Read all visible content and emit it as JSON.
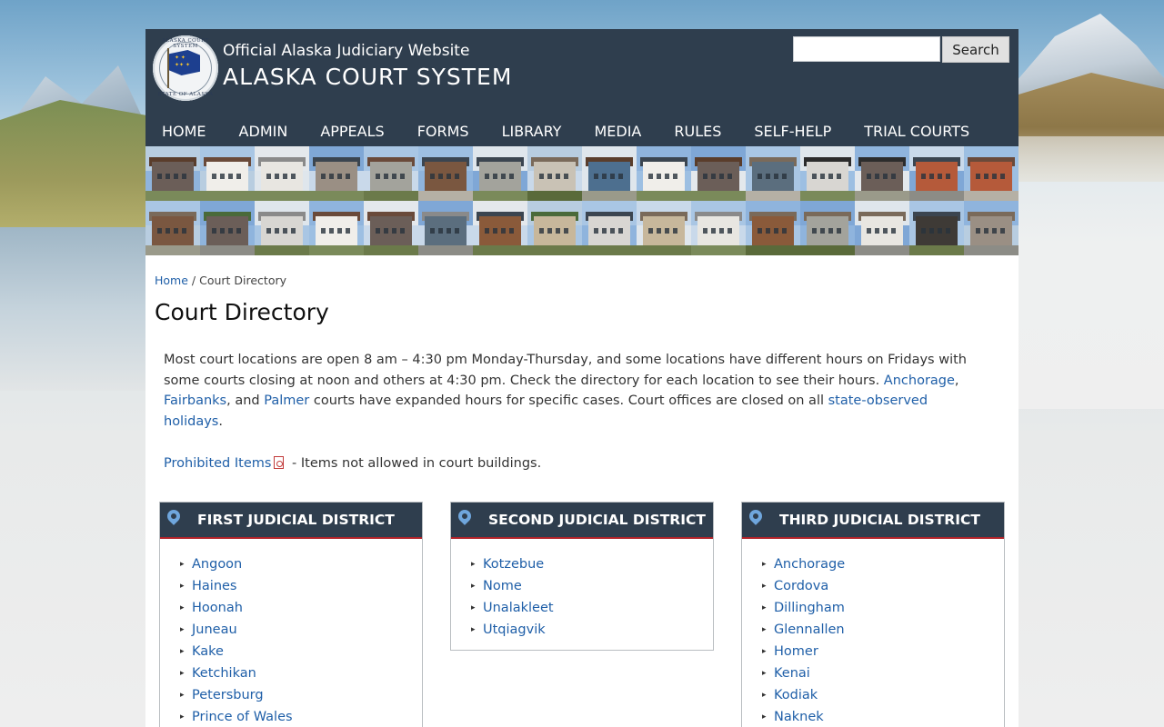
{
  "header": {
    "seal": {
      "top_text": "ALASKA COURT SYSTEM",
      "bottom_text": "STATE OF ALASKA"
    },
    "subtitle": "Official Alaska Judiciary Website",
    "title": "ALASKA COURT SYSTEM",
    "search": {
      "placeholder": "",
      "button_label": "Search"
    }
  },
  "nav": [
    "HOME",
    "ADMIN",
    "APPEALS",
    "FORMS",
    "LIBRARY",
    "MEDIA",
    "RULES",
    "SELF-HELP",
    "TRIAL COURTS"
  ],
  "breadcrumb": {
    "home": "Home",
    "separator": " / ",
    "current": "Court Directory"
  },
  "page_title": "Court Directory",
  "intro": {
    "text1": "Most court locations are open 8 am – 4:30 pm Monday-Thursday, and some locations have different hours on Fridays with some courts closing at noon and others at 4:30 pm. Check the directory for each location to see their hours. ",
    "link_anchorage": "Anchorage",
    "sep1": ", ",
    "link_fairbanks": "Fairbanks",
    "sep2": ", and ",
    "link_palmer": "Palmer",
    "text2": " courts have expanded hours for specific cases. Court offices are closed on all ",
    "link_holidays": "state-observed holidays",
    "text3": "."
  },
  "prohibited": {
    "link": "Prohibited Items",
    "text": " - Items not allowed in court buildings."
  },
  "districts": [
    {
      "title": "FIRST JUDICIAL DISTRICT",
      "courts": [
        "Angoon",
        "Haines",
        "Hoonah",
        "Juneau",
        "Kake",
        "Ketchikan",
        "Petersburg",
        "Prince of Wales"
      ]
    },
    {
      "title": "SECOND JUDICIAL DISTRICT",
      "courts": [
        "Kotzebue",
        "Nome",
        "Unalakleet",
        "Utqiagvik"
      ]
    },
    {
      "title": "THIRD JUDICIAL DISTRICT",
      "courts": [
        "Anchorage",
        "Cordova",
        "Dillingham",
        "Glennallen",
        "Homer",
        "Kenai",
        "Kodiak",
        "Naknek"
      ]
    }
  ],
  "colors": {
    "header_bg": "#2f3e4e",
    "link": "#1f5fa8",
    "district_accent": "#b2232a",
    "pin": "#6fa6dd"
  },
  "icons": {
    "district_pin": "map-pin-icon",
    "pdf": "pdf-icon",
    "list_bullet": "triangle-bullet-icon"
  }
}
